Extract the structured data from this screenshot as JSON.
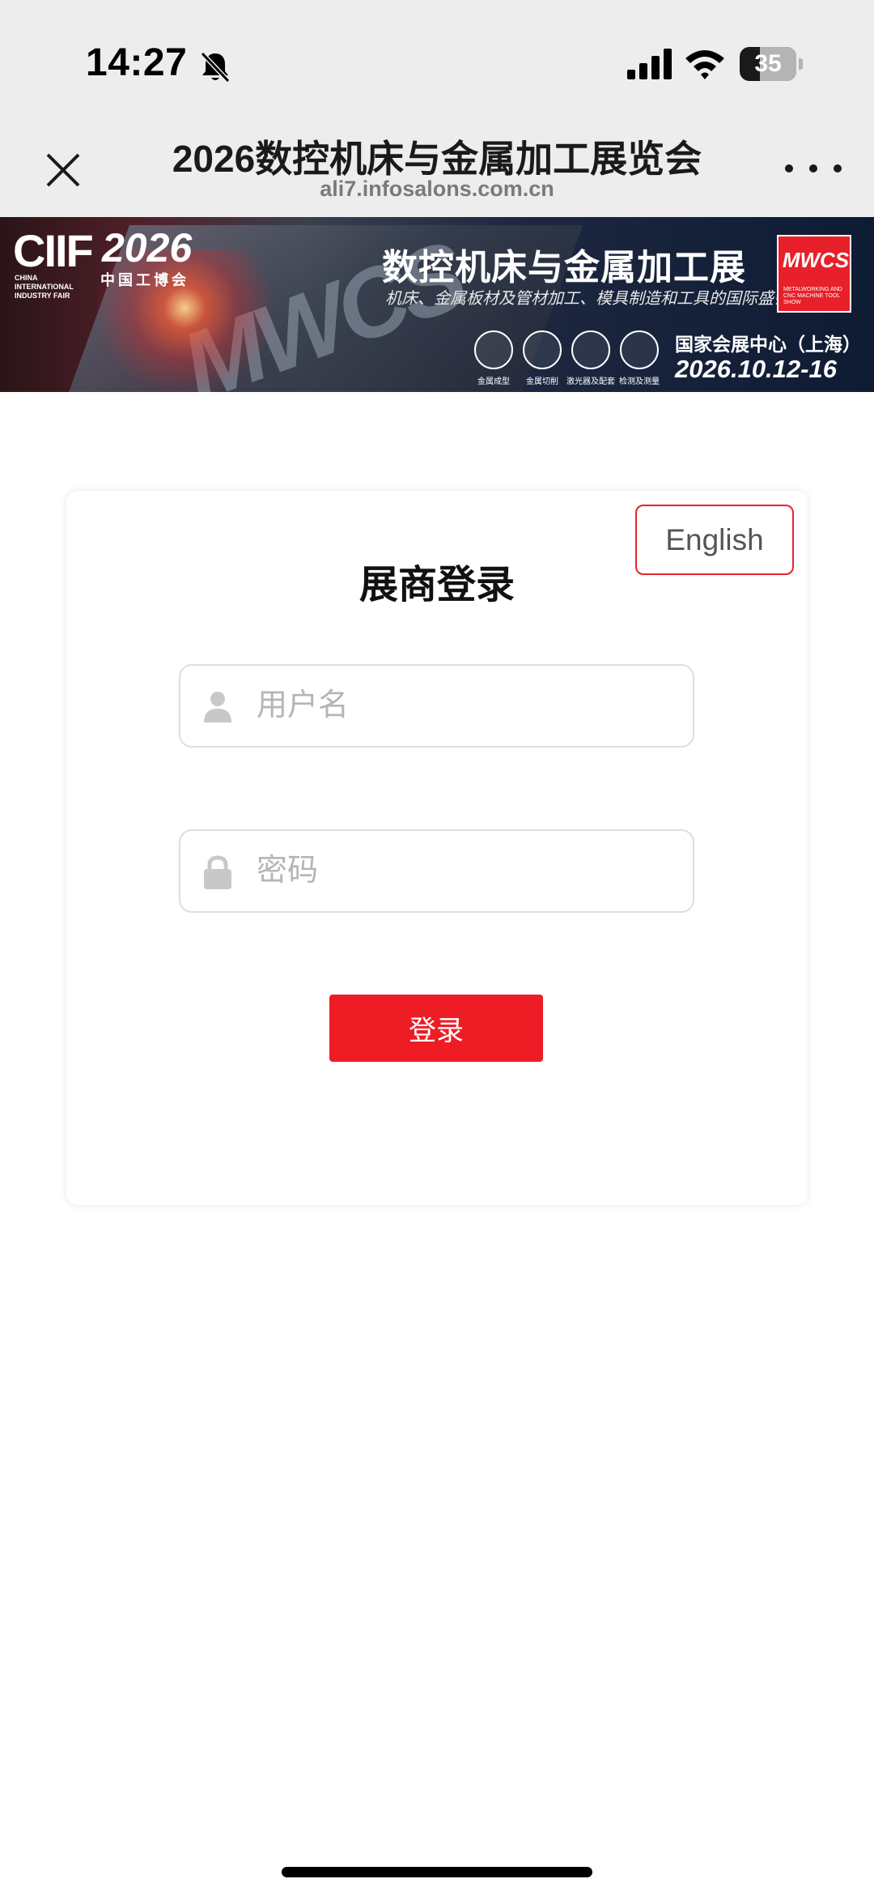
{
  "status_bar": {
    "time": "14:27",
    "battery": "35",
    "battery_level": 0.35,
    "icons": [
      "bell-slash-icon",
      "cellular-signal-icon",
      "wifi-icon",
      "battery-icon"
    ]
  },
  "header": {
    "title": "2026数控机床与金属加工展览会",
    "url": "ali7.infosalons.com.cn",
    "close_icon": "close-icon",
    "more_icon": "more-icon"
  },
  "banner": {
    "ciif_logo": "CIIF",
    "ciif_year": "2026",
    "ciif_en": "CHINA INTERNATIONAL INDUSTRY FAIR",
    "ciif_cn": "中国工博会",
    "title": "数控机床与金属加工展",
    "subtitle": "机床、金属板材及管材加工、模具制造和工具的国际盛会",
    "mwcs_logo": "MWCS",
    "mwcs_en": "METALWORKING AND CNC MACHINE TOOL SHOW",
    "categories": [
      "金属成型",
      "金属切削",
      "激光器及配套",
      "检测及测量"
    ],
    "venue": "国家会展中心（上海）",
    "date": "2026.10.12-16"
  },
  "login": {
    "language_button": "English",
    "title": "展商登录",
    "username_placeholder": "用户名",
    "password_placeholder": "密码",
    "submit": "登录"
  },
  "colors": {
    "accent": "#ee1c25",
    "lang_border": "#e5242f",
    "header_bg": "#ededed"
  }
}
